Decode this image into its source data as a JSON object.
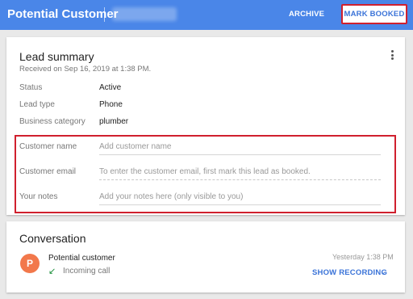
{
  "header": {
    "title": "Potential Customer",
    "phone": "(###) ###-####",
    "archive_label": "ARCHIVE",
    "mark_booked_label": "MARK BOOKED"
  },
  "summary": {
    "title": "Lead summary",
    "received": "Received on Sep 16, 2019 at 1:38 PM.",
    "rows": [
      {
        "label": "Status",
        "value": "Active"
      },
      {
        "label": "Lead type",
        "value": "Phone"
      },
      {
        "label": "Business category",
        "value": "plumber"
      }
    ],
    "fields": [
      {
        "label": "Customer name",
        "placeholder": "Add customer name"
      },
      {
        "label": "Customer email",
        "placeholder": "To enter the customer email, first mark this lead as booked."
      },
      {
        "label": "Your notes",
        "placeholder": "Add your notes here (only visible to you)"
      }
    ]
  },
  "conversation": {
    "title": "Conversation",
    "avatar_letter": "P",
    "name": "Potential customer",
    "call_type": "Incoming call",
    "time": "Yesterday 1:38 PM",
    "show_recording_label": "SHOW RECORDING"
  },
  "colors": {
    "header_bg": "#4a86e8",
    "accent": "#3a73d8",
    "highlight": "#d0202e",
    "avatar_bg": "#f2784b"
  }
}
